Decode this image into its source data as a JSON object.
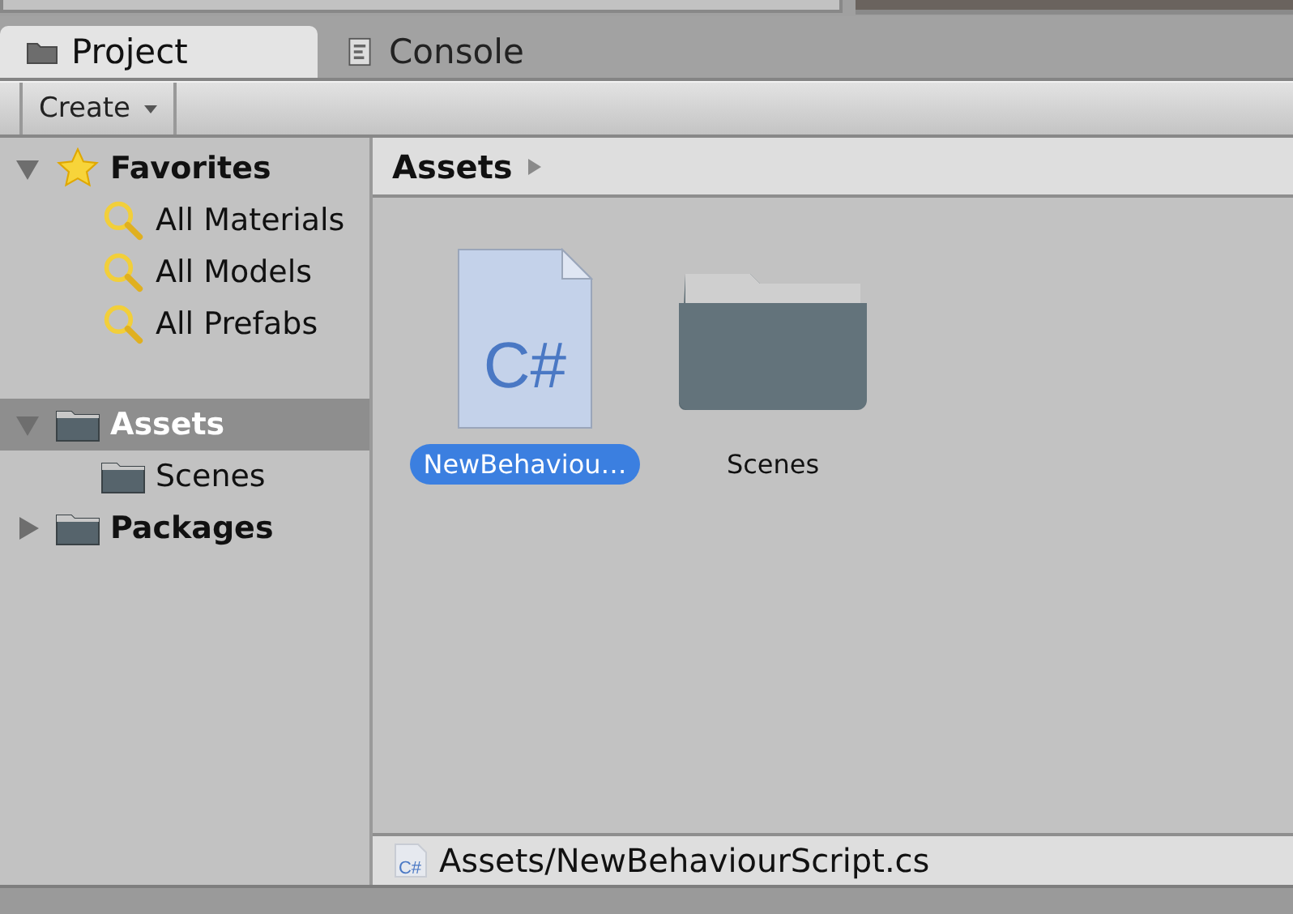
{
  "tabs": [
    {
      "label": "Project",
      "kind": "folder",
      "selected": true
    },
    {
      "label": "Console",
      "kind": "console",
      "selected": false
    }
  ],
  "toolbar": {
    "create_button": "Create"
  },
  "sidebar": {
    "tree": [
      {
        "label": "Favorites",
        "kind": "favorites",
        "expanded": true,
        "selected": false,
        "children": [
          {
            "label": "All Materials",
            "kind": "search",
            "selected": false
          },
          {
            "label": "All Models",
            "kind": "search",
            "selected": false
          },
          {
            "label": "All Prefabs",
            "kind": "search",
            "selected": false
          }
        ]
      },
      {
        "label": "Assets",
        "kind": "folder",
        "expanded": true,
        "selected": true,
        "children": [
          {
            "label": "Scenes",
            "kind": "folder",
            "selected": false
          }
        ]
      },
      {
        "label": "Packages",
        "kind": "folder",
        "expanded": false,
        "selected": false
      }
    ]
  },
  "breadcrumb": [
    "Assets"
  ],
  "assets": [
    {
      "name": "NewBehaviou…",
      "kind": "script",
      "icon_text": "C#",
      "selected": true
    },
    {
      "name": "Scenes",
      "kind": "folder",
      "selected": false
    }
  ],
  "status_bar": {
    "icon_text": "C#",
    "path": "Assets/NewBehaviourScript.cs"
  }
}
